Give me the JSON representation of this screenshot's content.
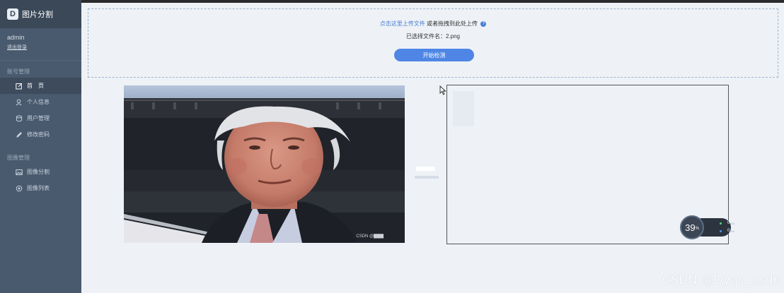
{
  "sidebar": {
    "brand_logo": "D",
    "brand_title": "图片分割",
    "user_name": "admin",
    "logout": "退出登录",
    "sections": [
      {
        "title": "账号管理",
        "items": [
          {
            "label": "首　页",
            "icon": "edit-icon",
            "active": true
          },
          {
            "label": "个人信息",
            "icon": "user-icon",
            "active": false
          },
          {
            "label": "用户管理",
            "icon": "database-icon",
            "active": false
          },
          {
            "label": "修改密码",
            "icon": "pen-icon",
            "active": false
          }
        ]
      },
      {
        "title": "图像管理",
        "items": [
          {
            "label": "图像分割",
            "icon": "image-icon",
            "active": false
          },
          {
            "label": "图像列表",
            "icon": "target-icon",
            "active": false
          }
        ]
      }
    ]
  },
  "upload": {
    "link": "点击这里上传文件",
    "or_drag": "或者拖拽到此处上传",
    "help": "?",
    "selected": "已选择文件名：2.png",
    "start_button": "开始检测"
  },
  "photo_watermark": "CSDN @▇▇▇",
  "speed": {
    "percent": "39",
    "percent_sign": "%",
    "up_value": "0",
    "up_unit": "K/s",
    "down_value": "0",
    "down_unit": "K/s",
    "up_color": "#5bd17a",
    "down_color": "#4a9cf0"
  },
  "watermark": "CSDN @Dyan_csdn",
  "colors": {
    "accent": "#4f86e6",
    "sidebar": "#4a5a6e"
  }
}
